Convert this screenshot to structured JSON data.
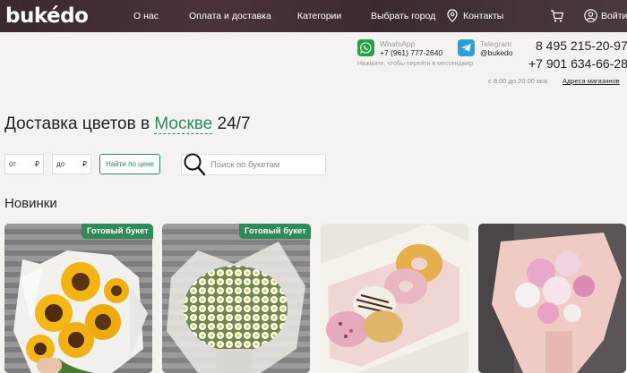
{
  "header": {
    "logo": "bukédo",
    "nav": [
      "О нас",
      "Оплата и доставка",
      "Категории",
      "Выбрать город",
      "Контакты"
    ],
    "login": "Войти"
  },
  "contacts": {
    "whatsapp": {
      "name": "WhatsApp",
      "handle": "+7 (961) 777-2640"
    },
    "telegram": {
      "name": "Telegram",
      "handle": "@bukedo"
    },
    "hint": "Нажмите, чтобы перейти в мессенджер",
    "phone1": "8 495 215-20-97",
    "phone2": "+7 901 634-66-28",
    "hours": "с 8:00 до 20:00 мск",
    "addresses": "Адреса магазинов"
  },
  "main": {
    "title_prefix": "Доставка цветов в",
    "city": "Москве",
    "title_suffix": "24/7"
  },
  "filter": {
    "from": "от",
    "to": "до",
    "currency": "₽",
    "find_button": "Найти по цене",
    "search_placeholder": "Поиск по букетам"
  },
  "section": {
    "title": "Новинки"
  },
  "products": [
    {
      "badge": "Готовый букет",
      "subject": "sunflower bouquet"
    },
    {
      "badge": "Готовый букет",
      "subject": "daisy bouquet"
    },
    {
      "badge": "",
      "subject": "box of glazed donuts"
    },
    {
      "badge": "",
      "subject": "pink flower bouquet"
    }
  ],
  "colors": {
    "accent": "#2e8b57",
    "header_bg": "#3a2a2c",
    "whatsapp": "#25a244",
    "telegram": "#2a9fd8"
  }
}
